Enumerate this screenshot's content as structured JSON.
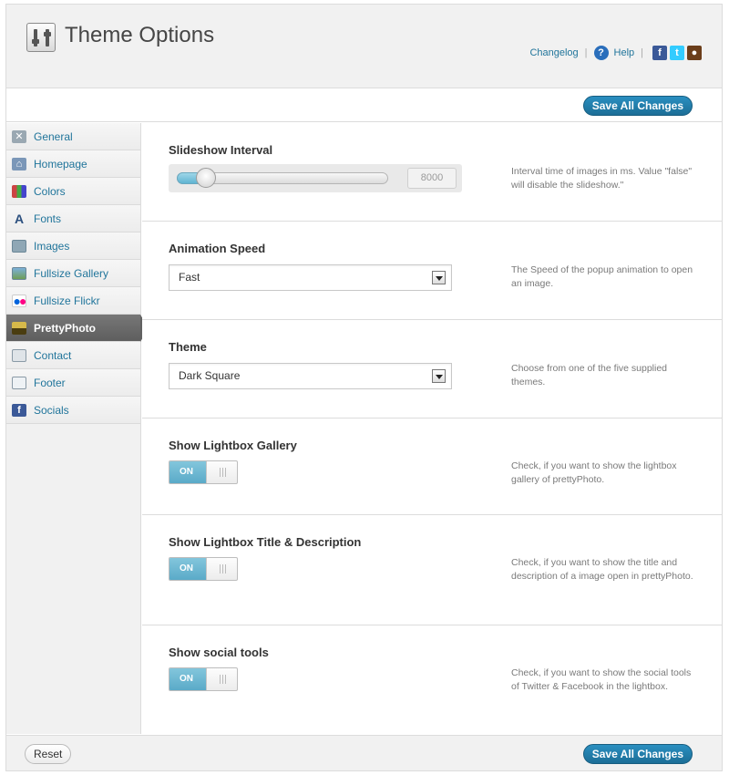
{
  "header": {
    "title": "Theme Options",
    "changelog": "Changelog",
    "help": "Help",
    "separator": "|"
  },
  "toolbar": {
    "save_label": "Save All Changes"
  },
  "sidebar": {
    "items": [
      {
        "label": "General",
        "icon": "tools-icon"
      },
      {
        "label": "Homepage",
        "icon": "home-icon"
      },
      {
        "label": "Colors",
        "icon": "palette-icon"
      },
      {
        "label": "Fonts",
        "icon": "font-icon"
      },
      {
        "label": "Images",
        "icon": "images-icon"
      },
      {
        "label": "Fullsize Gallery",
        "icon": "gallery-icon"
      },
      {
        "label": "Fullsize Flickr",
        "icon": "flickr-icon"
      },
      {
        "label": "PrettyPhoto",
        "icon": "prettyphoto-icon",
        "active": true
      },
      {
        "label": "Contact",
        "icon": "contact-card-icon"
      },
      {
        "label": "Footer",
        "icon": "footer-icon"
      },
      {
        "label": "Socials",
        "icon": "facebook-icon"
      }
    ]
  },
  "main": {
    "slideshow": {
      "title": "Slideshow Interval",
      "value": "8000",
      "level": 0.14,
      "description": "Interval time of images in ms. Value \"false\" will disable the slideshow.\""
    },
    "animation": {
      "title": "Animation Speed",
      "selected": "Fast",
      "description": "The Speed of the popup animation to open an image."
    },
    "theme": {
      "title": "Theme",
      "selected": "Dark Square",
      "description": "Choose from one of the five supplied themes."
    },
    "gallery": {
      "title": "Show Lightbox Gallery",
      "state": "ON",
      "description": "Check, if you want to show the lightbox gallery of prettyPhoto."
    },
    "title_desc": {
      "title": "Show Lightbox Title & Description",
      "state": "ON",
      "description": "Check, if you want to show the title and description of a image open in prettyPhoto."
    },
    "social": {
      "title": "Show social tools",
      "state": "ON",
      "description": "Check, if you want to show the social tools of Twitter & Facebook in the lightbox."
    }
  },
  "footer": {
    "reset_label": "Reset",
    "save_label": "Save All Changes"
  },
  "colors": {
    "accent": "#21759b",
    "toggle_on": "#5aaac8",
    "active_nav": "#626262"
  }
}
